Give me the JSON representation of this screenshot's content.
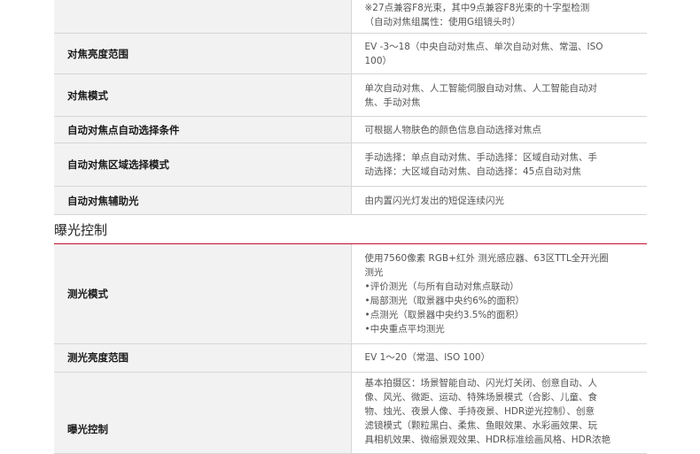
{
  "af_section": {
    "rows": [
      {
        "label": "",
        "lines": [
          "※27点兼容F8光束，其中9点兼容F8光束的十字型检测",
          "（自动对焦组属性：使用G组镜头时）"
        ]
      },
      {
        "label": "对焦亮度范围",
        "lines": [
          "EV -3～18（中央自动对焦点、单次自动对焦、常温、ISO",
          "100）"
        ]
      },
      {
        "label": "对焦模式",
        "lines": [
          "单次自动对焦、人工智能伺服自动对焦、人工智能自动对",
          "焦、手动对焦"
        ]
      },
      {
        "label": "自动对焦点自动选择条件",
        "lines": [
          "可根据人物肤色的颜色信息自动选择对焦点"
        ]
      },
      {
        "label": "自动对焦区域选择模式",
        "lines": [
          "手动选择：单点自动对焦、手动选择：区域自动对焦、手",
          "动选择：大区域自动对焦、自动选择：45点自动对焦"
        ]
      },
      {
        "label": "自动对焦辅助光",
        "lines": [
          "由内置闪光灯发出的短促连续闪光"
        ]
      }
    ]
  },
  "exposure_section": {
    "title": "曝光控制",
    "rows": [
      {
        "label": "测光模式",
        "lines": [
          "使用7560像素 RGB+红外 测光感应器、63区TTL全开光圈",
          "测光",
          "•评价测光（与所有自动对焦点联动）",
          "•局部测光（取景器中央约6%的面积）",
          "•点测光（取景器中央约3.5%的面积）",
          "•中央重点平均测光"
        ]
      },
      {
        "label": "测光亮度范围",
        "lines": [
          "EV 1～20（常温、ISO 100）"
        ]
      },
      {
        "label": "曝光控制",
        "lines": [
          "基本拍摄区：场景智能自动、闪光灯关闭、创意自动、人",
          "像、风光、微距、运动、特殊场景模式（合影、儿童、食",
          "物、烛光、夜景人像、手持夜景、HDR逆光控制）、创意",
          "滤镜模式（颗粒黑白、柔焦、鱼眼效果、水彩画效果、玩",
          "具相机效果、微缩景观效果、HDR标准绘画风格、HDR浓艳"
        ]
      }
    ]
  }
}
